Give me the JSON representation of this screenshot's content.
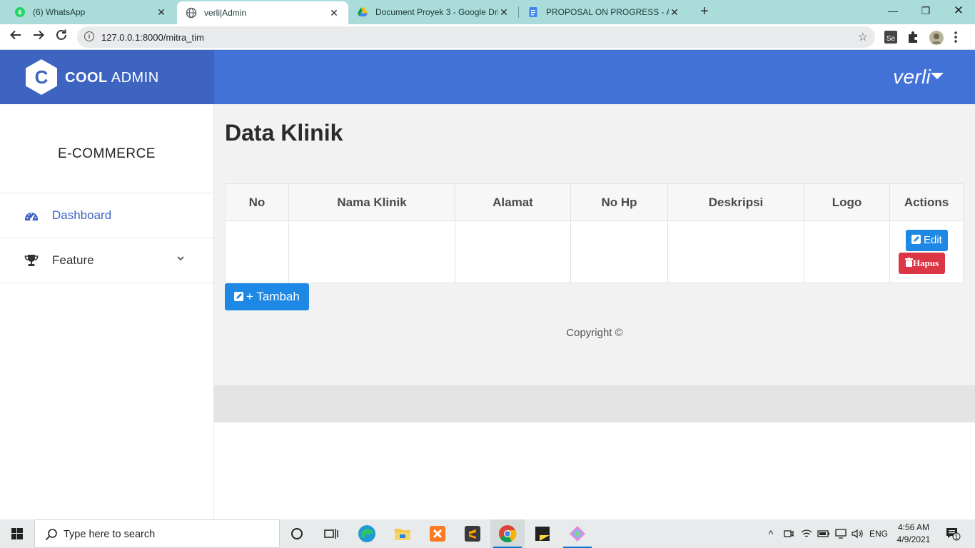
{
  "browser": {
    "tabs": [
      {
        "title": "(6) WhatsApp",
        "icon": "whatsapp-icon",
        "active": false
      },
      {
        "title": "verli|Admin",
        "icon": "globe-icon",
        "active": true
      },
      {
        "title": "Document Proyek 3 - Google Dri",
        "icon": "google-drive-icon",
        "active": false
      },
      {
        "title": "PROPOSAL ON PROGRESS - APL",
        "icon": "google-docs-icon",
        "active": false
      }
    ],
    "url": "127.0.0.1:8000/mitra_tim",
    "whatsapp_badge": "6"
  },
  "app": {
    "logo_bold": "COOL",
    "logo_rest": "ADMIN",
    "logo_letter": "C",
    "user": "verli"
  },
  "sidebar": {
    "brand": "E-COMMERCE",
    "items": [
      {
        "label": "Dashboard",
        "icon": "tachometer-icon",
        "active": true
      },
      {
        "label": "Feature",
        "icon": "trophy-icon",
        "active": false
      }
    ]
  },
  "page": {
    "title": "Data Klinik",
    "table": {
      "columns": [
        "No",
        "Nama Klinik",
        "Alamat",
        "No Hp",
        "Deskripsi",
        "Logo",
        "Actions"
      ],
      "rows": [
        {
          "no": "",
          "nama_klinik": "",
          "alamat": "",
          "no_hp": "",
          "deskripsi": "",
          "logo": ""
        }
      ]
    },
    "edit_label": "Edit",
    "delete_label": "Hapus",
    "add_label": "+ Tambah",
    "copyright": "Copyright ©"
  },
  "taskbar": {
    "search_placeholder": "Type here to search",
    "language": "ENG",
    "time": "4:56 AM",
    "date": "4/9/2021",
    "notification_count": "1"
  },
  "colors": {
    "sidebar_logo_bg": "#3c64c0",
    "topbar_bg": "#4272d7",
    "edit_button": "#1e88e5",
    "delete_button": "#dc3545",
    "active_nav": "#3d64c2"
  }
}
